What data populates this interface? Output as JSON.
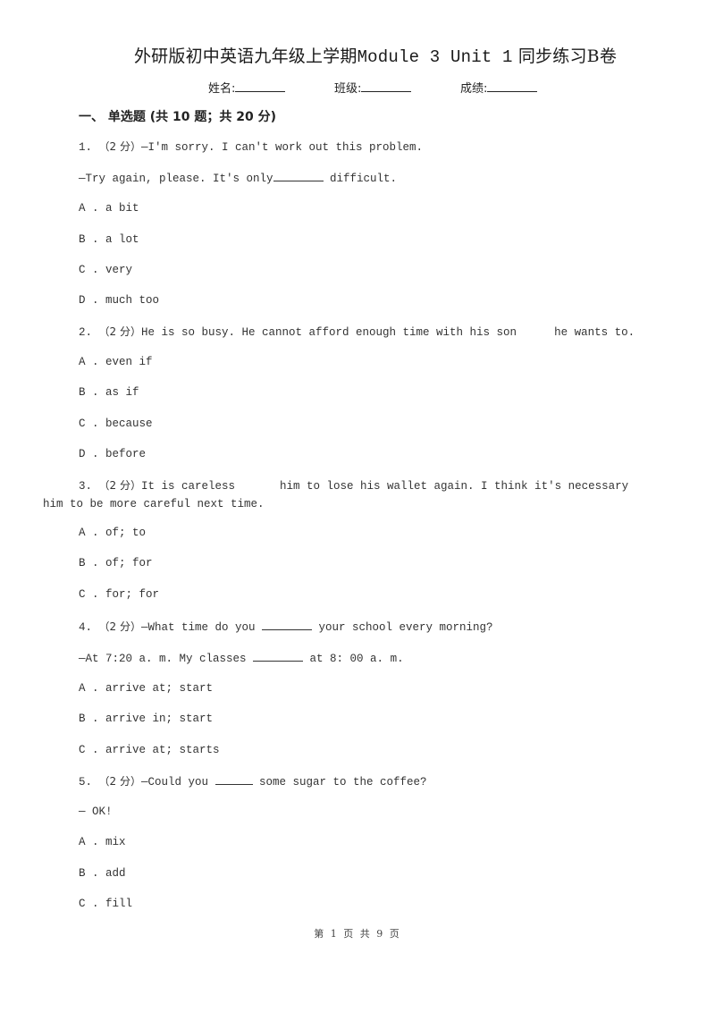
{
  "document": {
    "title_cn_prefix": "外研版初中英语九年级上学期",
    "title_mono": "Module 3 Unit 1",
    "title_cn_suffix": "同步练习B卷",
    "fields": [
      {
        "label": "姓名:"
      },
      {
        "label": "班级:"
      },
      {
        "label": "成绩:"
      }
    ],
    "section_heading": "一、  单选题 (共 10 题；共 20 分)",
    "questions": [
      {
        "number": "1.",
        "score": "（2 分）",
        "stem_line1": "—I'm sorry. I can't work out this problem.",
        "stem_line2_pre": "—Try again, please. It's only",
        "stem_line2_post": " difficult.",
        "options": [
          {
            "letter": "A .",
            "text": "a bit"
          },
          {
            "letter": "B .",
            "text": "a lot"
          },
          {
            "letter": "C .",
            "text": "very"
          },
          {
            "letter": "D .",
            "text": "much too"
          }
        ]
      },
      {
        "number": "2.",
        "score": "（2 分）",
        "stem_line1_pre": "He is so busy. He cannot afford enough time with his son",
        "stem_line1_post": "he wants to.",
        "options": [
          {
            "letter": "A .",
            "text": "even if"
          },
          {
            "letter": "B .",
            "text": "as if"
          },
          {
            "letter": "C .",
            "text": "because"
          },
          {
            "letter": "D .",
            "text": "before"
          }
        ]
      },
      {
        "number": "3.",
        "score": "（2 分）",
        "stem_line1_pre": "It is careless",
        "stem_line1_post": "him to lose his wallet again. I think it's necessary",
        "stem_line2": "him to be more careful next time.",
        "options": [
          {
            "letter": "A .",
            "text": "of; to"
          },
          {
            "letter": "B .",
            "text": "of; for"
          },
          {
            "letter": "C .",
            "text": "for; for"
          }
        ]
      },
      {
        "number": "4.",
        "score": "（2 分）",
        "stem_line1_pre": "—What time do you ",
        "stem_line1_post": " your school every morning?",
        "stem_line2_pre": "—At 7:20 a. m. My classes ",
        "stem_line2_post": " at 8: 00 a. m.",
        "options": [
          {
            "letter": "A .",
            "text": "arrive at; start"
          },
          {
            "letter": "B .",
            "text": "arrive in; start"
          },
          {
            "letter": "C .",
            "text": "arrive at; starts"
          }
        ]
      },
      {
        "number": "5.",
        "score": "（2 分）",
        "stem_line1_pre": "—Could you ",
        "stem_line1_post": " some sugar to the coffee?",
        "stem_line2": "— OK!",
        "options": [
          {
            "letter": "A .",
            "text": "mix"
          },
          {
            "letter": "B .",
            "text": "add"
          },
          {
            "letter": "C .",
            "text": "fill"
          }
        ]
      }
    ],
    "footer": "第 1 页 共 9 页"
  }
}
